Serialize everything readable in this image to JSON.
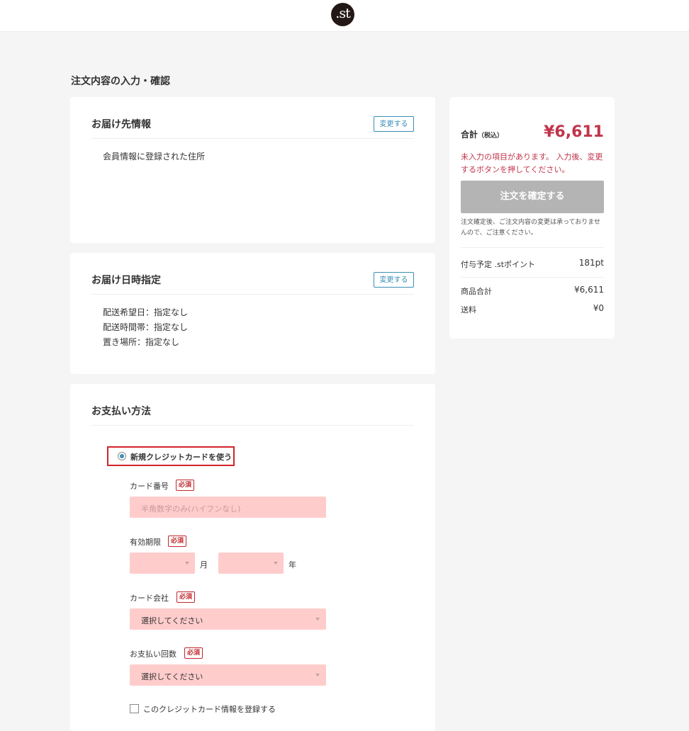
{
  "header": {
    "logo": ".st"
  },
  "page": {
    "title": "注文内容の入力・確認"
  },
  "delivery": {
    "title": "お届け先情報",
    "change_label": "変更する",
    "address_text": "会員情報に登録された住所"
  },
  "delivery_time": {
    "title": "お届け日時指定",
    "change_label": "変更する",
    "lines": [
      "配送希望日：指定なし",
      "配送時間帯：指定なし",
      "置き場所：指定なし"
    ]
  },
  "payment": {
    "title": "お支払い方法",
    "new_card_label": "新規クレジットカードを使う",
    "required_label": "必須",
    "card_number": {
      "label": "カード番号",
      "placeholder": "半角数字のみ(ハイフンなし)"
    },
    "expiry": {
      "label": "有効期限",
      "month_unit": "月",
      "year_unit": "年"
    },
    "card_company": {
      "label": "カード会社",
      "value": "選択してください"
    },
    "installments": {
      "label": "お支払い回数",
      "value": "選択してください"
    },
    "save_card_label": "このクレジットカード情報を登録する"
  },
  "summary": {
    "total_label": "合計",
    "tax_note": "（税込）",
    "total_amount": "¥6,611",
    "warning": "未入力の項目があります。 入力後、変更するボタンを押してください。",
    "confirm_label": "注文を確定する",
    "note": "注文確定後、ご注文内容の変更は承っておりませんので、ご注意ください。",
    "points_label": "付与予定 .stポイント",
    "points_value": "181pt",
    "subtotal_label": "商品合計",
    "subtotal_value": "¥6,611",
    "shipping_label": "送料",
    "shipping_value": "¥0"
  },
  "colors": {
    "accent": "#3a8fb7",
    "price": "#c1344b",
    "required": "#c1272d",
    "input_bg": "#ffcccc",
    "highlight_frame": "#d3232a"
  }
}
